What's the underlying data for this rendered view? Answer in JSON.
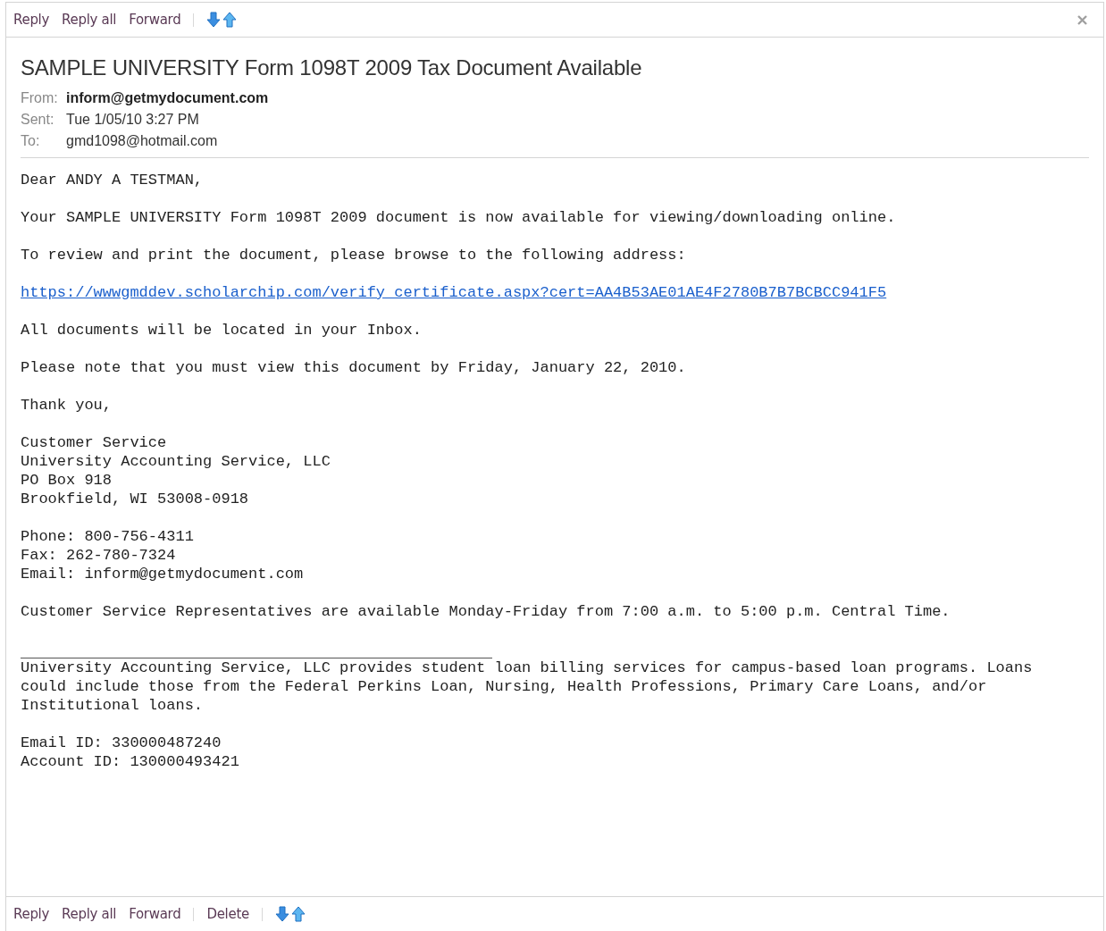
{
  "top_toolbar": {
    "groups": [
      [
        "Reply",
        "Reply all",
        "Forward"
      ]
    ]
  },
  "message": {
    "subject": "SAMPLE UNIVERSITY Form 1098T 2009 Tax Document Available",
    "fields": [
      {
        "kind": "from",
        "label": "From:",
        "value": "inform@getmydocument.com"
      },
      {
        "kind": "plain",
        "label": "Sent:",
        "value": "Tue 1/05/10 3:27 PM"
      },
      {
        "kind": "plain",
        "label": "To:",
        "value": "gmd1098@hotmail.com"
      }
    ],
    "body": [
      {
        "kind": "text",
        "lines": [
          "Dear ANDY A TESTMAN,"
        ]
      },
      {
        "kind": "text",
        "lines": [
          "Your SAMPLE UNIVERSITY Form 1098T 2009 document is now available for viewing/downloading online."
        ]
      },
      {
        "kind": "text",
        "lines": [
          "To review and print the document, please browse to the following address:"
        ]
      },
      {
        "kind": "link",
        "lines": [
          "https://wwwgmddev.scholarchip.com/verify_certificate.aspx?cert=AA4B53AE01AE4F2780B7B7BCBCC941F5"
        ]
      },
      {
        "kind": "text",
        "lines": [
          "All documents will be located in your Inbox."
        ]
      },
      {
        "kind": "text",
        "lines": [
          "Please note that you must view this document by Friday, January 22, 2010."
        ]
      },
      {
        "kind": "text",
        "lines": [
          "Thank you,"
        ]
      },
      {
        "kind": "text",
        "lines": [
          "Customer Service",
          "University Accounting Service, LLC",
          "PO Box 918",
          "Brookfield, WI 53008-0918"
        ]
      },
      {
        "kind": "text",
        "lines": [
          "Phone: 800-756-4311",
          "Fax: 262-780-7324",
          "Email: inform@getmydocument.com"
        ]
      },
      {
        "kind": "text",
        "lines": [
          "Customer Service Representatives are available Monday-Friday from 7:00 a.m. to 5:00 p.m. Central Time."
        ]
      },
      {
        "kind": "rule"
      },
      {
        "kind": "text",
        "lines": [
          "University Accounting Service, LLC provides student loan billing services for campus-based loan programs. Loans",
          "could include those from the Federal Perkins Loan, Nursing, Health Professions, Primary Care Loans, and/or",
          "Institutional loans."
        ]
      },
      {
        "kind": "text",
        "lines": [
          "Email ID: 330000487240",
          "Account ID: 130000493421"
        ]
      }
    ]
  },
  "bottom_toolbar": {
    "groups": [
      [
        "Reply",
        "Reply all",
        "Forward"
      ],
      [
        "Delete"
      ]
    ]
  }
}
